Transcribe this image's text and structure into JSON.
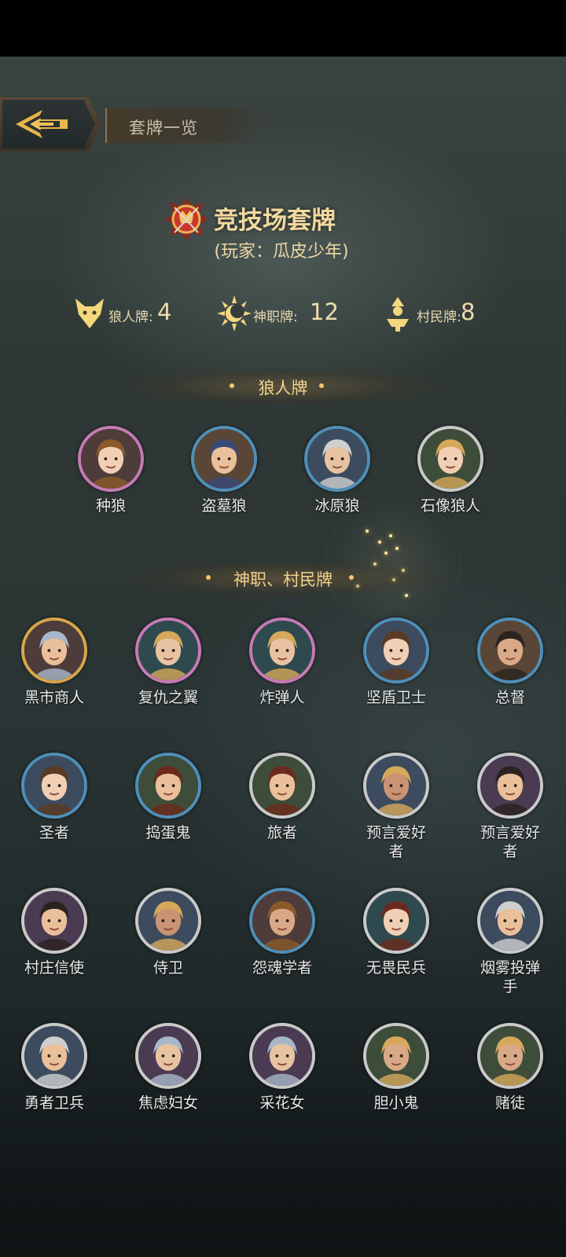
{
  "header": {
    "title": "套牌一览"
  },
  "deck": {
    "title": "竞技场套牌",
    "player": "(玩家：瓜皮少年)"
  },
  "counts": [
    {
      "label": "狼人牌:",
      "value": "4",
      "icon": "wolf-icon"
    },
    {
      "label": "神职牌:",
      "value": "12",
      "icon": "sun-moon-icon"
    },
    {
      "label": "村民牌:",
      "value": "8",
      "icon": "villager-icon"
    }
  ],
  "sections": {
    "werewolf": "狼人牌",
    "god_villager": "神职、村民牌"
  },
  "werewolf_cards": [
    {
      "name": "种狼",
      "ring": "purple"
    },
    {
      "name": "盗墓狼",
      "ring": "blue"
    },
    {
      "name": "冰原狼",
      "ring": "blue"
    },
    {
      "name": "石像狼人",
      "ring": "silver"
    }
  ],
  "role_cards": [
    {
      "name": "黑市商人",
      "ring": "gold"
    },
    {
      "name": "复仇之翼",
      "ring": "purple"
    },
    {
      "name": "炸弹人",
      "ring": "purple"
    },
    {
      "name": "坚盾卫士",
      "ring": "blue"
    },
    {
      "name": "总督",
      "ring": "blue"
    },
    {
      "name": "圣者",
      "ring": "blue"
    },
    {
      "name": "捣蛋鬼",
      "ring": "blue"
    },
    {
      "name": "旅者",
      "ring": "silver"
    },
    {
      "name": "预言爱好者",
      "ring": "silver"
    },
    {
      "name": "预言爱好者",
      "ring": "silver"
    },
    {
      "name": "村庄信使",
      "ring": "silver"
    },
    {
      "name": "侍卫",
      "ring": "silver"
    },
    {
      "name": "怨魂学者",
      "ring": "blue"
    },
    {
      "name": "无畏民兵",
      "ring": "silver"
    },
    {
      "name": "烟雾投弹手",
      "ring": "silver"
    },
    {
      "name": "勇者卫兵",
      "ring": "silver"
    },
    {
      "name": "焦虑妇女",
      "ring": "silver"
    },
    {
      "name": "采花女",
      "ring": "silver"
    },
    {
      "name": "胆小鬼",
      "ring": "silver"
    },
    {
      "name": "赌徒",
      "ring": "silver"
    }
  ]
}
